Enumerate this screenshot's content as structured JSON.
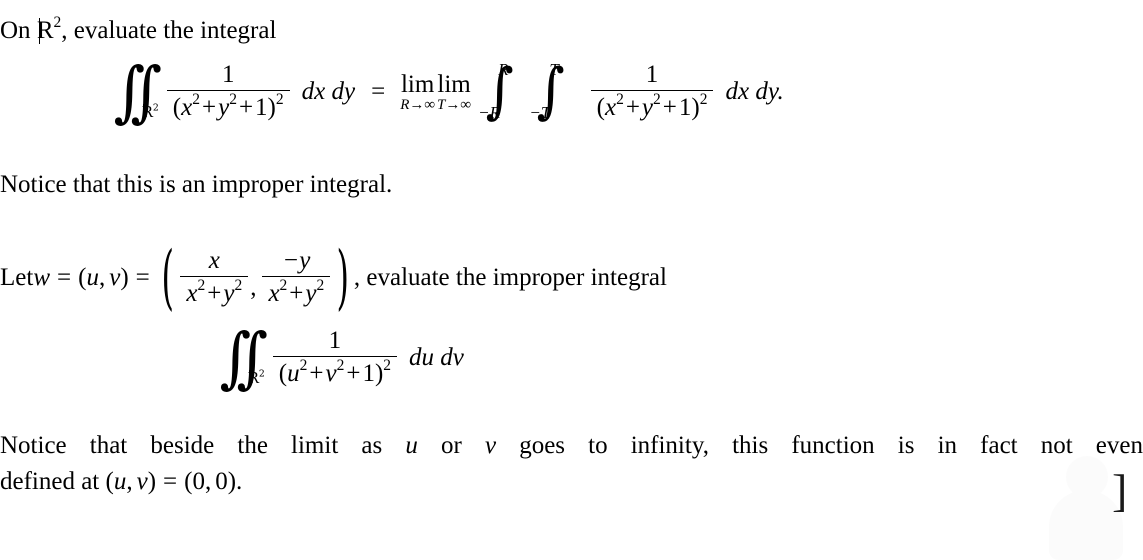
{
  "document": {
    "intro_line": {
      "prefix": "On ",
      "domain_symbol": "R",
      "domain_exponent": "2",
      "suffix": ", evaluate the integral"
    },
    "equation_main": {
      "lhs": {
        "integral_glyphs": "∫∫",
        "integral_subscript_symbol": "R",
        "integral_subscript_exponent": "2",
        "numerator": "1",
        "denominator_open": "(",
        "denominator_x": "x",
        "denominator_x_exp": "2",
        "denominator_plus1": "+",
        "denominator_y": "y",
        "denominator_y_exp": "2",
        "denominator_plus2": "+",
        "denominator_one": "1",
        "denominator_close": ")",
        "denominator_exp": "2",
        "differentials": "dx dy"
      },
      "relation": "=",
      "rhs": {
        "limit1_name": "lim",
        "limit1_sub": "R→∞",
        "limit2_name": "lim",
        "limit2_sub": "T→∞",
        "integral1_glyph": "∫",
        "integral1_upper": "R",
        "integral1_lower": "−R",
        "integral2_glyph": "∫",
        "integral2_upper": "T",
        "integral2_lower": "−T",
        "numerator": "1",
        "denominator_open": "(",
        "denominator_x": "x",
        "denominator_x_exp": "2",
        "denominator_plus1": "+",
        "denominator_y": "y",
        "denominator_y_exp": "2",
        "denominator_plus2": "+",
        "denominator_one": "1",
        "denominator_close": ")",
        "denominator_exp": "2",
        "differentials": "dx dy."
      }
    },
    "notice_improper": "Notice that this is an improper integral.",
    "let_line": {
      "prefix": "Let ",
      "w": "w",
      "eq1": "=",
      "tuple_open": "(",
      "u": "u",
      "comma": ",",
      "v": "v",
      "tuple_close": ")",
      "eq2": "=",
      "paren_open": "(",
      "frac1_num": "x",
      "frac1_den_x": "x",
      "frac1_den_x_exp": "2",
      "frac1_den_plus": "+",
      "frac1_den_y": "y",
      "frac1_den_y_exp": "2",
      "separator": ",",
      "frac2_num": "−y",
      "frac2_den_x": "x",
      "frac2_den_x_exp": "2",
      "frac2_den_plus": "+",
      "frac2_den_y": "y",
      "frac2_den_y_exp": "2",
      "paren_close": ")",
      "suffix": ", evaluate the improper integral"
    },
    "equation_uv": {
      "integral_glyphs": "∫∫",
      "integral_subscript_symbol": "R",
      "integral_subscript_exponent": "2",
      "numerator": "1",
      "denominator_open": "(",
      "denominator_u": "u",
      "denominator_u_exp": "2",
      "denominator_plus1": "+",
      "denominator_v": "v",
      "denominator_v_exp": "2",
      "denominator_plus2": "+",
      "denominator_one": "1",
      "denominator_close": ")",
      "denominator_exp": "2",
      "differentials": "du dv"
    },
    "final_paragraph": {
      "line1_part1": "Notice that beside the limit as ",
      "line1_u": "u",
      "line1_part2": " or ",
      "line1_v": "v",
      "line1_part3": " goes to infinity, this function is in fact not even",
      "line2_prefix": "defined at ",
      "line2_open": "(",
      "line2_u": "u",
      "line2_comma": ",",
      "line2_v": "v",
      "line2_close": ")",
      "line2_eq": "=",
      "line2_value_open": "(",
      "line2_zero1": "0",
      "line2_value_comma": ",",
      "line2_zero2": "0",
      "line2_value_close": ")",
      "line2_period": "."
    },
    "artifacts": {
      "bracket_glyph": "]",
      "caret_glyph": "✐"
    },
    "colors": {
      "text": "#000000",
      "background": "#ffffff",
      "watermark": "#fbfbfb",
      "bracket": "#1a1a1a"
    }
  }
}
